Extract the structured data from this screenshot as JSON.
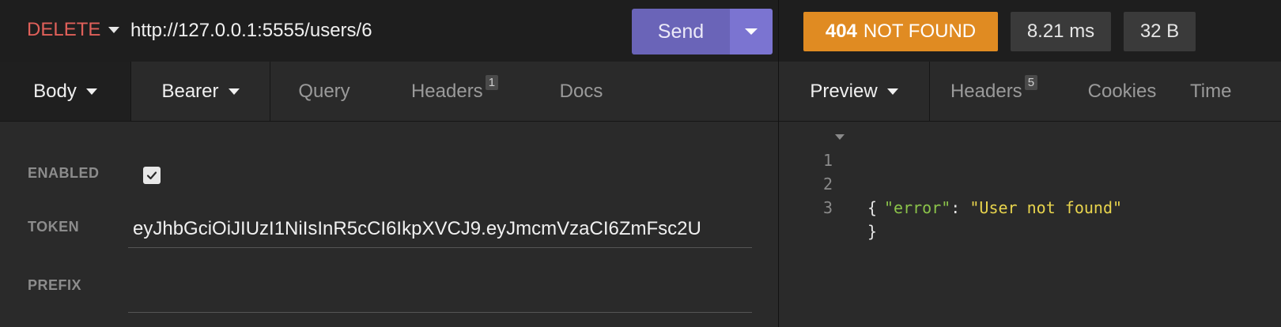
{
  "request": {
    "method": "DELETE",
    "url": "http://127.0.0.1:5555/users/6",
    "send_label": "Send",
    "tabs": [
      {
        "label": "Body",
        "has_caret": true
      },
      {
        "label": "Bearer",
        "has_caret": true
      },
      {
        "label": "Query"
      },
      {
        "label": "Headers",
        "badge": "1"
      },
      {
        "label": "Docs"
      }
    ],
    "auth": {
      "enabled_label": "ENABLED",
      "enabled": true,
      "token_label": "TOKEN",
      "token_value": "eyJhbGciOiJIUzI1NiIsInR5cCI6IkpXVCJ9.eyJmcmVzaCI6ZmFsc2U",
      "prefix_label": "PREFIX",
      "prefix_value": ""
    }
  },
  "response": {
    "status_code": "404",
    "status_text": "NOT FOUND",
    "time": "8.21 ms",
    "size": "32 B",
    "tabs": [
      {
        "label": "Preview",
        "has_caret": true
      },
      {
        "label": "Headers",
        "badge": "5"
      },
      {
        "label": "Cookies"
      },
      {
        "label": "Time"
      }
    ],
    "preview": {
      "line_numbers": [
        "1",
        "2",
        "3"
      ],
      "open_brace": "{",
      "key": "\"error\"",
      "colon": ": ",
      "value": "\"User not found\"",
      "close_brace": "}"
    }
  },
  "colors": {
    "method": "#e0605a",
    "send": "#6a64b8",
    "status_404": "#e08b22",
    "json_key": "#8bc34a",
    "json_string": "#e8d44d"
  }
}
